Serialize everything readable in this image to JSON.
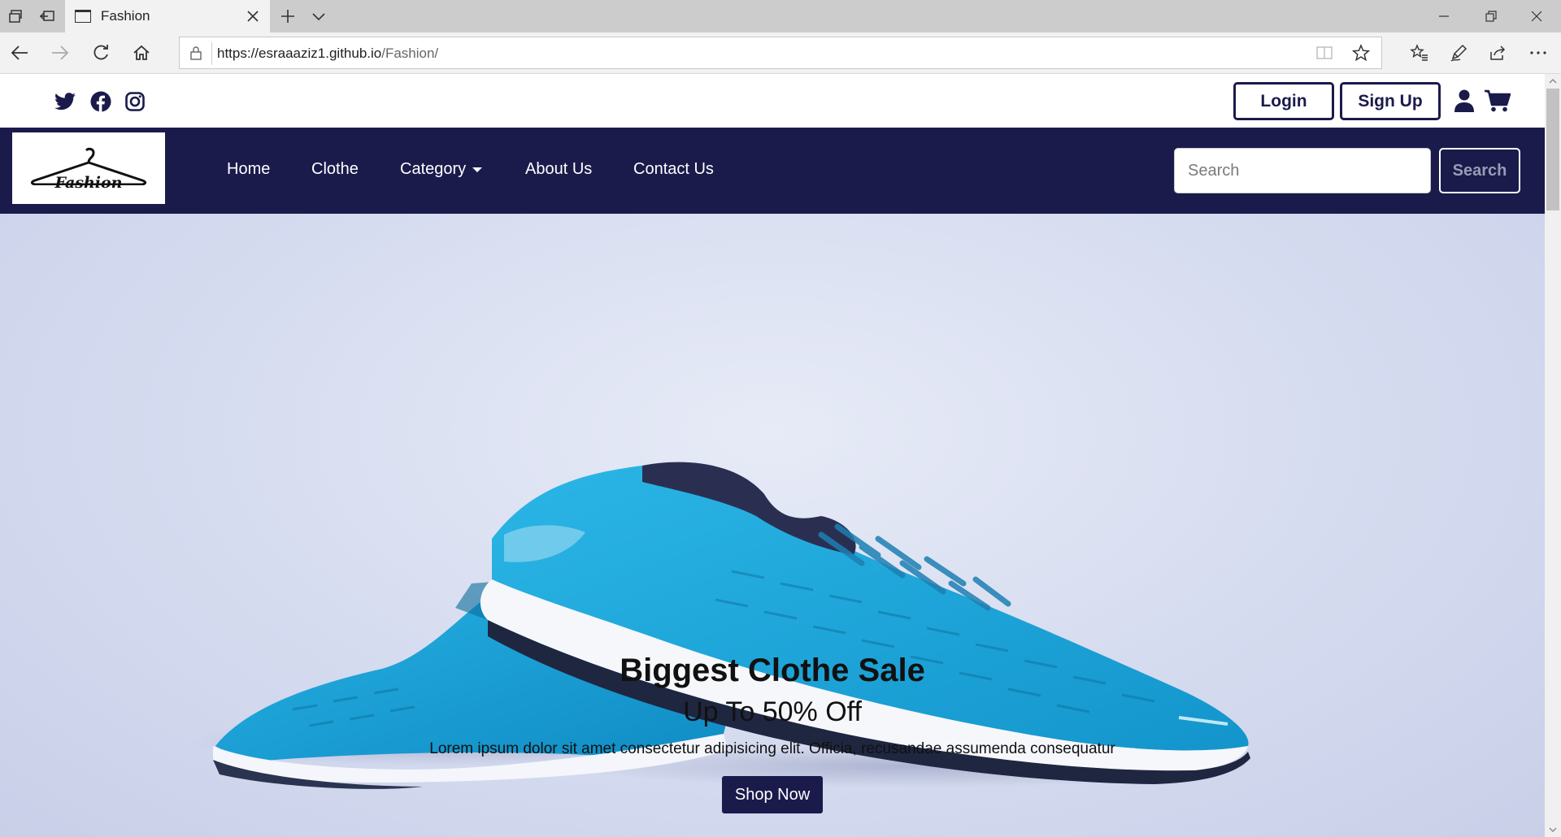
{
  "browser": {
    "tab_title": "Fashion",
    "url_host": "https://esraaaziz1.github.io",
    "url_path": "/Fashion/",
    "tab_icons": [
      "tab-manager-icon",
      "set-aside-tabs-icon"
    ],
    "new_tab_icon": "plus-icon",
    "tab_list_icon": "chevron-down-icon",
    "window_controls": [
      "minimize-icon",
      "restore-icon",
      "close-icon"
    ],
    "toolbar_icons": [
      "favorites-icon",
      "pen-icon",
      "share-icon",
      "more-icon"
    ]
  },
  "site": {
    "social_icons": [
      "twitter-icon",
      "facebook-icon",
      "instagram-icon"
    ],
    "login_label": "Login",
    "signup_label": "Sign Up",
    "user_icon": "user-icon",
    "cart_icon": "cart-icon",
    "brand": "Fashion",
    "nav": {
      "home": "Home",
      "clothe": "Clothe",
      "category": "Category",
      "about": "About Us",
      "contact": "Contact Us"
    },
    "search": {
      "placeholder": "Search",
      "button": "Search"
    },
    "hero": {
      "title": "Biggest Clothe Sale",
      "subtitle": "Up To 50% Off",
      "text": "Lorem ipsum dolor sit amet consectetur adipisicing elit. Officia, recusandae assumenda consequatur",
      "button": "Shop Now"
    },
    "colors": {
      "navy": "#1a1b4b",
      "shoe_blue": "#1aa3d6"
    }
  }
}
